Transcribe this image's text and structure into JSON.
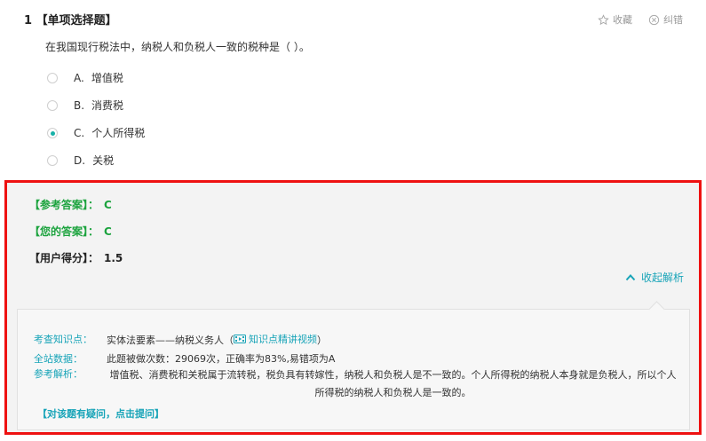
{
  "question": {
    "number": "1",
    "type": "【单项选择题】",
    "text": "在我国现行税法中，纳税人和负税人一致的税种是（   ）。",
    "favorite_label": "收藏",
    "report_label": "纠错",
    "options": [
      {
        "letter": "A.",
        "text": "增值税",
        "selected": false
      },
      {
        "letter": "B.",
        "text": "消费税",
        "selected": false
      },
      {
        "letter": "C.",
        "text": "个人所得税",
        "selected": true
      },
      {
        "letter": "D.",
        "text": "关税",
        "selected": false
      }
    ]
  },
  "answer": {
    "reference_label": "【参考答案】：",
    "reference_value": "C",
    "yours_label": "【您的答案】：",
    "yours_value": "C",
    "score_label": "【用户得分】：",
    "score_value": "1.5",
    "collapse_label": "收起解析"
  },
  "analysis": {
    "knowledge_label": "考查知识点：",
    "knowledge_value": "实体法要素——纳税义务人（",
    "video_label": "知识点精讲视频",
    "knowledge_close": "）",
    "stats_label": "全站数据：",
    "stats_value": "此题被做次数：29069次，正确率为83%,易错项为A",
    "explain_label": "参考解析：",
    "explain_value": "增值税、消费税和关税属于流转税，税负具有转嫁性，纳税人和负税人是不一致的。个人所得税的纳税人本身就是负税人，所以个人所得税的纳税人和负税人是一致的。",
    "question_link": "【对该题有疑问，点击提问】"
  },
  "colors": {
    "accent": "#18a4b8",
    "answer_green": "#1ca33e",
    "highlight_border": "#ee1111",
    "radio_selected": "#18b1a8"
  }
}
